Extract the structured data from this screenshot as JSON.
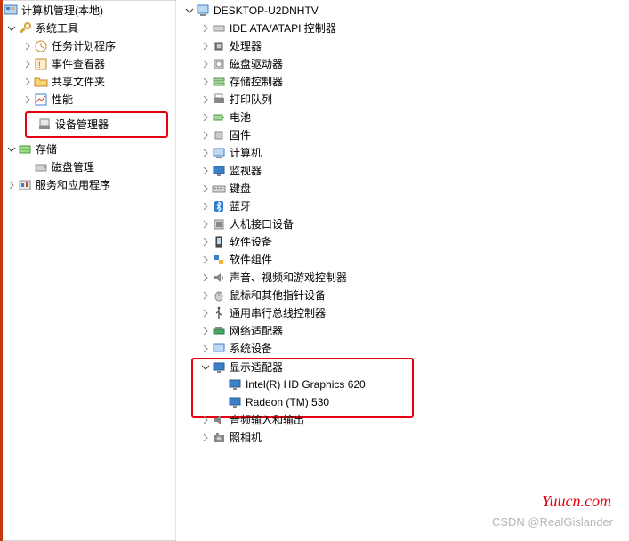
{
  "left_panel": {
    "root": "计算机管理(本地)",
    "system_tools": "系统工具",
    "task_scheduler": "任务计划程序",
    "event_viewer": "事件查看器",
    "shared_folders": "共享文件夹",
    "performance": "性能",
    "device_manager": "设备管理器",
    "storage": "存储",
    "disk_management": "磁盘管理",
    "services_apps": "服务和应用程序"
  },
  "right_panel": {
    "computer_name": "DESKTOP-U2DNHTV",
    "ide_ata": "IDE ATA/ATAPI 控制器",
    "processors": "处理器",
    "disk_drives": "磁盘驱动器",
    "storage_ctrl": "存储控制器",
    "print_queues": "打印队列",
    "batteries": "电池",
    "firmware": "固件",
    "computer": "计算机",
    "monitors": "监视器",
    "keyboards": "键盘",
    "bluetooth": "蓝牙",
    "hid": "人机接口设备",
    "software_devices": "软件设备",
    "software_components": "软件组件",
    "sound_video": "声音、视频和游戏控制器",
    "mice": "鼠标和其他指针设备",
    "usb_ctrl": "通用串行总线控制器",
    "network_adapters": "网络适配器",
    "system_devices": "系统设备",
    "display_adapters": "显示适配器",
    "intel_gpu": "Intel(R) HD Graphics 620",
    "radeon_gpu": "Radeon (TM) 530",
    "audio_io": "音频输入和输出",
    "cameras": "照相机"
  },
  "watermark": {
    "site": "Yuucn.com",
    "csdn": "CSDN @RealGislander"
  },
  "colors": {
    "highlight_border": "#e60012"
  }
}
